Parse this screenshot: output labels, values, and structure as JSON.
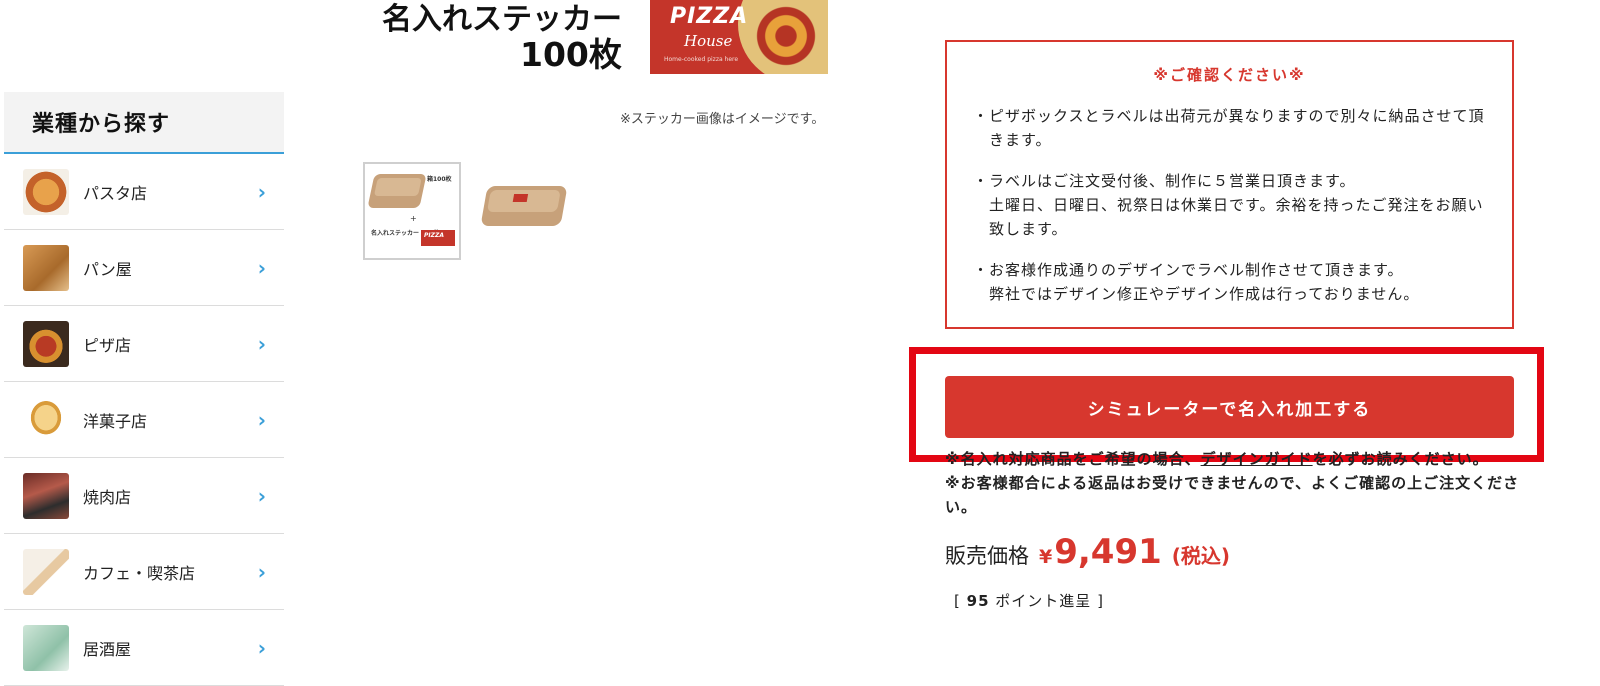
{
  "product_image": {
    "sticker_line1": "名入れステッカー",
    "sticker_line2": "100枚",
    "logo_word": "PIZZA",
    "logo_script": "House",
    "logo_tagline": "Home-cooked pizza here",
    "image_note": "※ステッカー画像はイメージです。",
    "thumb1": {
      "box_tag": "箱100枚",
      "plus": "+",
      "sticker_name": "名入れステッカー 100枚",
      "sticker_word": "PIZZA"
    }
  },
  "sidebar": {
    "heading": "業種から探す",
    "chevron": "›",
    "items": [
      {
        "label": "パスタ店",
        "thumb": "pasta"
      },
      {
        "label": "パン屋",
        "thumb": "bread"
      },
      {
        "label": "ピザ店",
        "thumb": "pizza"
      },
      {
        "label": "洋菓子店",
        "thumb": "cake"
      },
      {
        "label": "焼肉店",
        "thumb": "meat"
      },
      {
        "label": "カフェ・喫茶店",
        "thumb": "cafe"
      },
      {
        "label": "居酒屋",
        "thumb": "izakaya"
      }
    ]
  },
  "notice": {
    "title": "※ご確認ください※",
    "items": [
      "ピザボックスとラベルは出荷元が異なりますので別々に納品させて頂きます。",
      "ラベルはご注文受付後、制作に５営業日頂きます。\n土曜日、日曜日、祝祭日は休業日です。余裕を持ったご発注をお願い致します。",
      "お客様作成通りのデザインでラベル制作させて頂きます。\n弊社ではデザイン修正やデザイン作成は行っておりません。"
    ]
  },
  "cta": {
    "button_label": "シミュレーターで名入れ加工する",
    "guide_prefix": "※名入れ対応商品をご希望の場合、",
    "guide_link": "デザインガイド",
    "guide_suffix": "を必ずお読みください。",
    "return_note": "※お客様都合による返品はお受けできませんので、よくご確認の上ご注文ください。"
  },
  "price": {
    "label": "販売価格",
    "currency": "¥",
    "value": "9,491",
    "tax": "(税込)",
    "points_open": "[",
    "points_value": "95",
    "points_text": "ポイント進呈",
    "points_close": "]"
  },
  "colors": {
    "accent_red": "#d7372e",
    "highlight_red": "#e30613",
    "sidebar_accent": "#3b9fd8"
  }
}
